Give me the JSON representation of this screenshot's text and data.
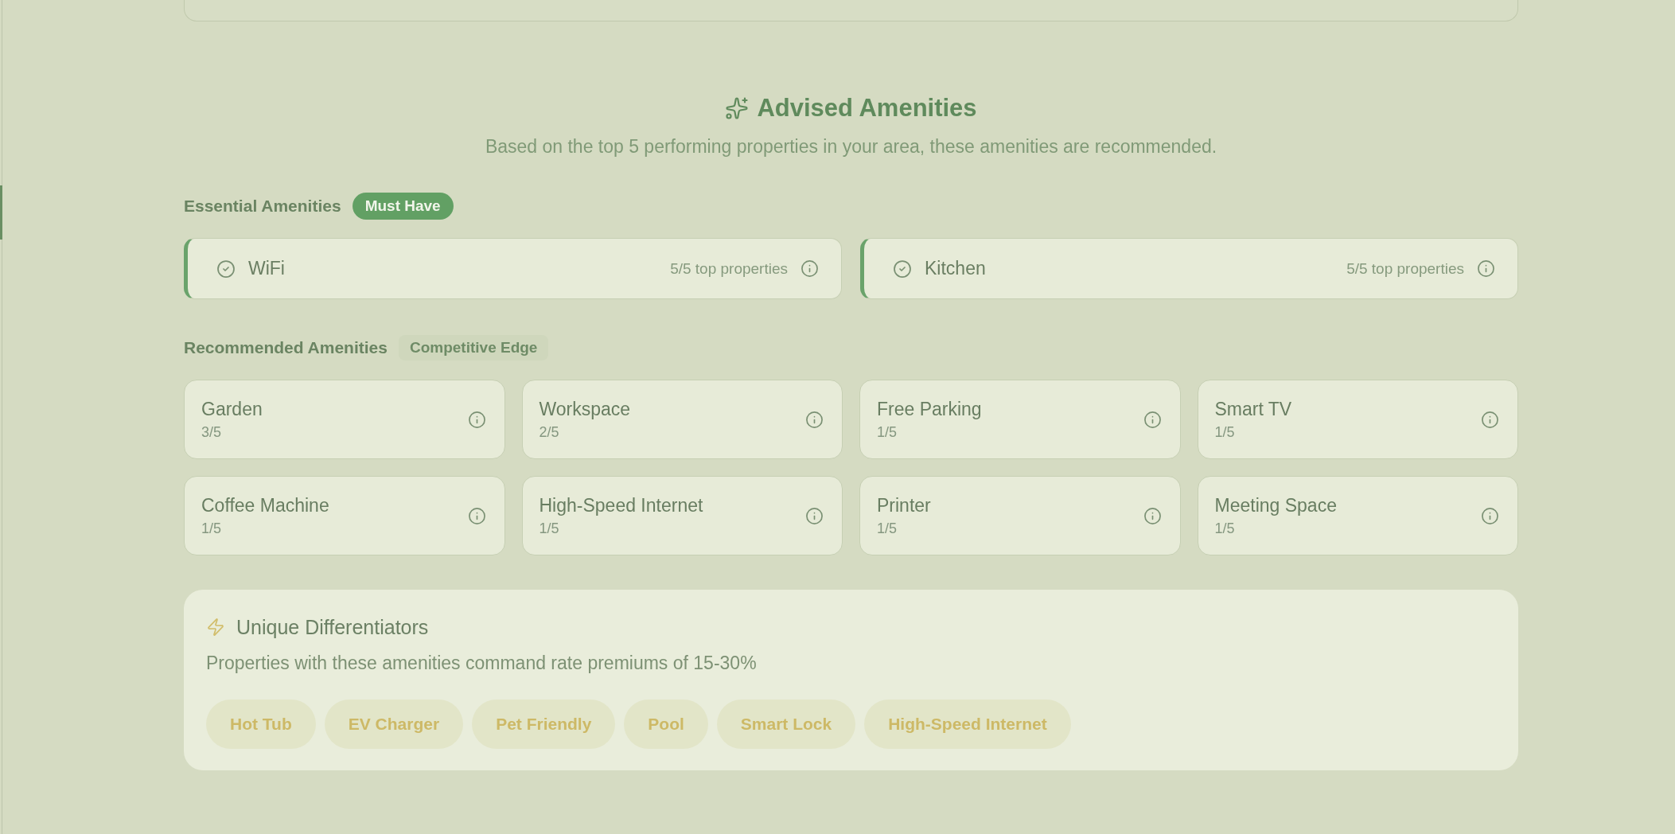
{
  "header": {
    "title": "Advised Amenities",
    "subtitle": "Based on the top 5 performing properties in your area, these amenities are recommended."
  },
  "sections": [
    {
      "kind": "essential",
      "label": "Essential Amenities",
      "badge": "Must Have",
      "items": [
        {
          "name": "WiFi",
          "count": "5/5 top properties"
        },
        {
          "name": "Kitchen",
          "count": "5/5 top properties"
        }
      ]
    },
    {
      "kind": "recommended",
      "label": "Recommended Amenities",
      "badge": "Competitive Edge",
      "items": [
        {
          "name": "Garden",
          "count": "3/5"
        },
        {
          "name": "Workspace",
          "count": "2/5"
        },
        {
          "name": "Free Parking",
          "count": "1/5"
        },
        {
          "name": "Smart TV",
          "count": "1/5"
        },
        {
          "name": "Coffee Machine",
          "count": "1/5"
        },
        {
          "name": "High-Speed Internet",
          "count": "1/5"
        },
        {
          "name": "Printer",
          "count": "1/5"
        },
        {
          "name": "Meeting Space",
          "count": "1/5"
        }
      ]
    }
  ],
  "differentiators": {
    "title": "Unique Differentiators",
    "subtitle": "Properties with these amenities command rate premiums of 15-30%",
    "chips": [
      "Hot Tub",
      "EV Charger",
      "Pet Friendly",
      "Pool",
      "Smart Lock",
      "High-Speed Internet"
    ]
  }
}
